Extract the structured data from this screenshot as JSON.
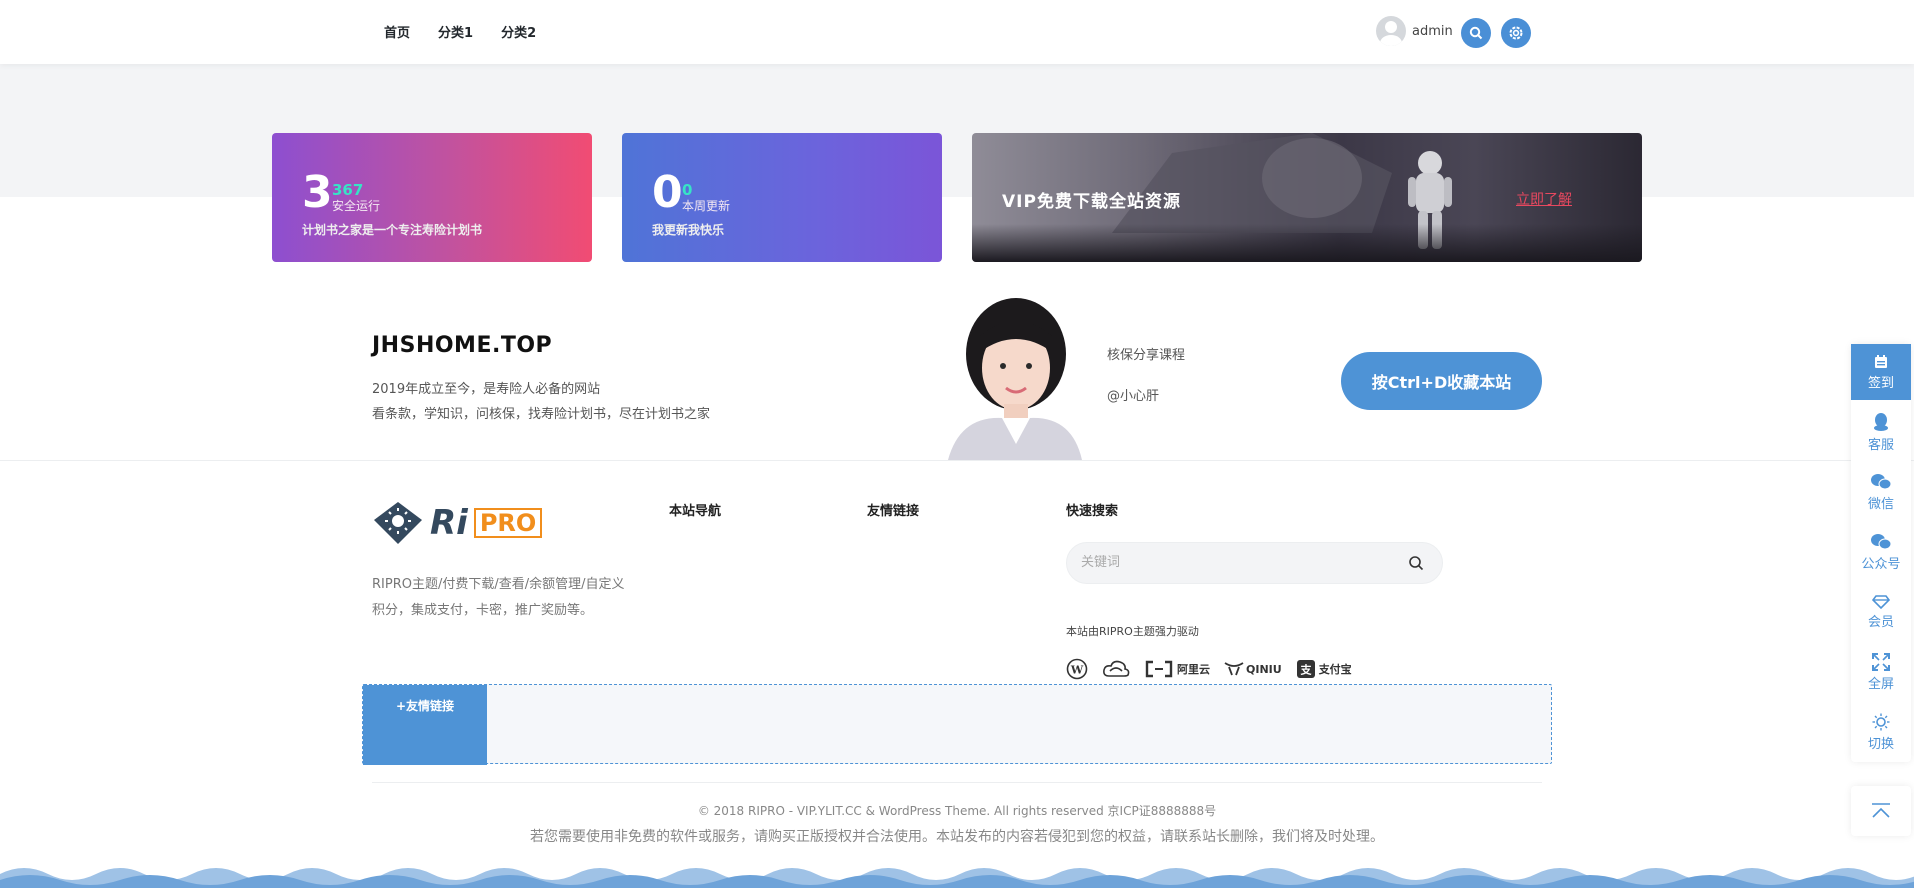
{
  "nav": {
    "items": [
      "首页",
      "分类1",
      "分类2"
    ]
  },
  "user": {
    "name": "admin"
  },
  "stats": [
    {
      "big": "3",
      "small": "367",
      "unit": "安全运行",
      "desc": "计划书之家是一个专注寿险计划书"
    },
    {
      "big": "0",
      "small": "0",
      "unit": "本周更新",
      "desc": "我更新我快乐"
    }
  ],
  "vip_banner": {
    "title": "VIP免费下载全站资源",
    "link": "立即了解"
  },
  "about": {
    "title": "JHSHOME.TOP",
    "line1": "2019年成立至今，是寿险人必备的网站",
    "line2": "看条款，学知识，问核保，找寿险计划书，尽在计划书之家",
    "meta1": "核保分享课程",
    "meta2": "@小心肝",
    "cta": "按Ctrl+D收藏本站"
  },
  "footer": {
    "logo_ri": "Ri",
    "logo_pro": "PRO",
    "desc1": "RIPRO主题/付费下载/查看/余额管理/自定义",
    "desc2": "积分，集成支付，卡密，推广奖励等。",
    "col_nav": "本站导航",
    "col_links": "友情链接",
    "col_search": "快速搜索",
    "search_placeholder": "关键词",
    "powered": "本站由RIPRO主题强力驱动",
    "brands": [
      "阿里云",
      "QINIU",
      "支付宝"
    ],
    "friend_link_btn": "+友情链接",
    "copyright": "© 2018 RIPRO - VIP.YLIT.CC & WordPress Theme. All rights reserved 京ICP证8888888号",
    "disclaimer": "若您需要使用非免费的软件或服务，请购买正版授权并合法使用。本站发布的内容若侵犯到您的权益，请联系站长删除，我们将及时处理。"
  },
  "sidebar": {
    "items": [
      {
        "label": "签到",
        "icon": "calendar-icon"
      },
      {
        "label": "客服",
        "icon": "qq-icon"
      },
      {
        "label": "微信",
        "icon": "wechat-icon"
      },
      {
        "label": "公众号",
        "icon": "wechat-official-icon"
      },
      {
        "label": "会员",
        "icon": "diamond-icon"
      },
      {
        "label": "全屏",
        "icon": "fullscreen-icon"
      },
      {
        "label": "切换",
        "icon": "sun-icon"
      }
    ]
  },
  "colors": {
    "accent": "#4e93d6",
    "vip_link": "#e8485f",
    "stat_small": "#37e3c6"
  }
}
